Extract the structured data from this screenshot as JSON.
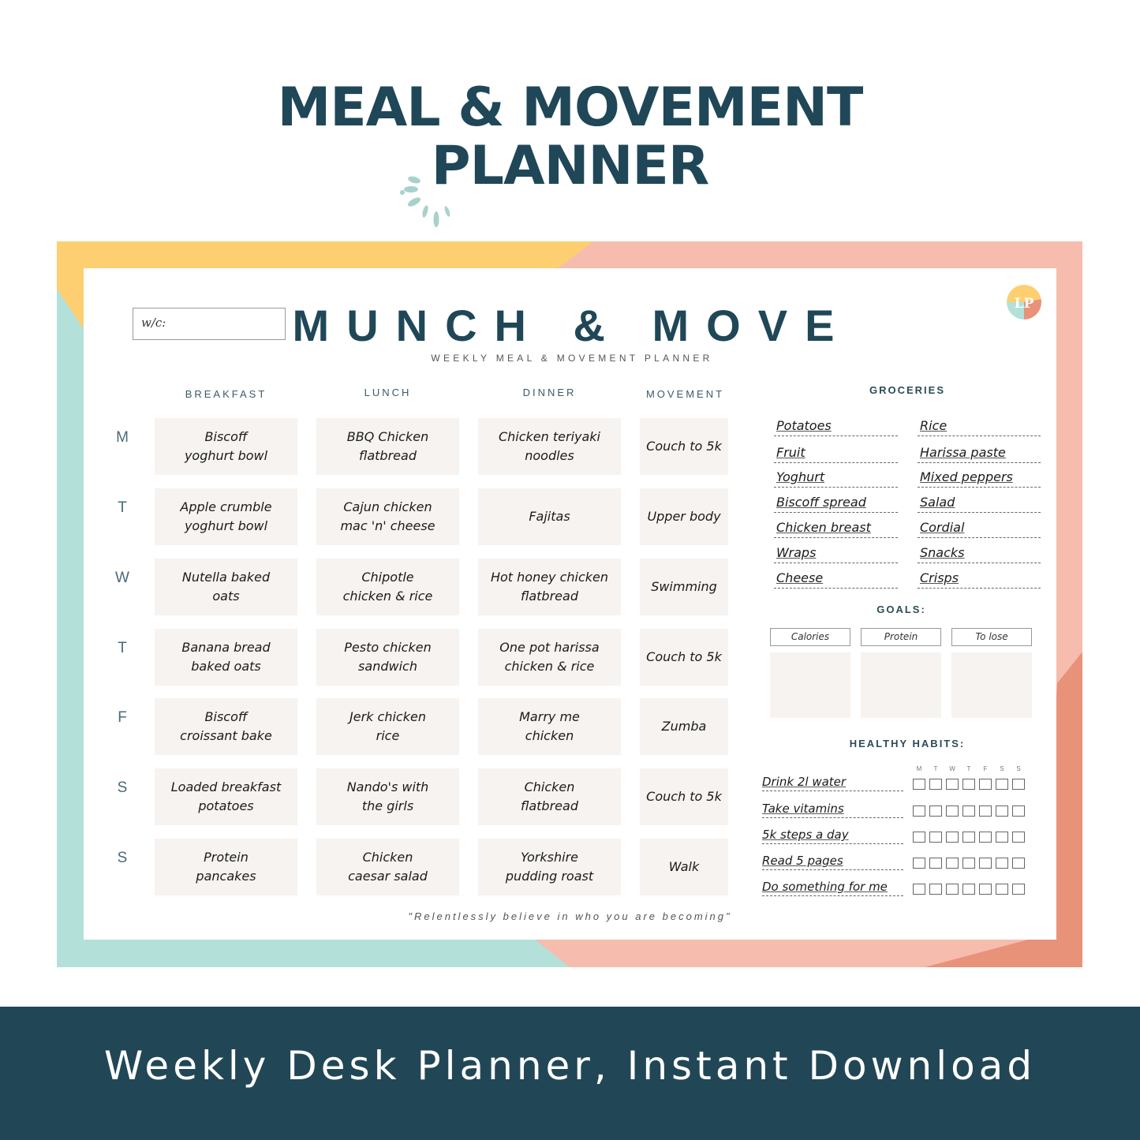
{
  "hero": {
    "title_line1": "MEAL & MOVEMENT",
    "title_line2": "PLANNER"
  },
  "planner": {
    "week_commencing_label": "w/c:",
    "title": "MUNCH & MOVE",
    "subtitle": "WEEKLY MEAL & MOVEMENT PLANNER",
    "logo_text": "LP",
    "columns": [
      "BREAKFAST",
      "LUNCH",
      "DINNER",
      "MOVEMENT"
    ],
    "days": [
      {
        "label": "M",
        "breakfast": "Biscoff\nyoghurt bowl",
        "lunch": "BBQ Chicken\nflatbread",
        "dinner": "Chicken teriyaki\nnoodles",
        "movement": "Couch to 5k"
      },
      {
        "label": "T",
        "breakfast": "Apple crumble\nyoghurt bowl",
        "lunch": "Cajun chicken\nmac 'n' cheese",
        "dinner": "Fajitas",
        "movement": "Upper body"
      },
      {
        "label": "W",
        "breakfast": "Nutella baked\noats",
        "lunch": "Chipotle\nchicken & rice",
        "dinner": "Hot honey chicken\nflatbread",
        "movement": "Swimming"
      },
      {
        "label": "T",
        "breakfast": "Banana bread\nbaked oats",
        "lunch": "Pesto chicken\nsandwich",
        "dinner": "One pot harissa\nchicken & rice",
        "movement": "Couch to 5k"
      },
      {
        "label": "F",
        "breakfast": "Biscoff\ncroissant bake",
        "lunch": "Jerk chicken\nrice",
        "dinner": "Marry me\nchicken",
        "movement": "Zumba"
      },
      {
        "label": "S",
        "breakfast": "Loaded breakfast\npotatoes",
        "lunch": "Nando's with\nthe girls",
        "dinner": "Chicken\nflatbread",
        "movement": "Couch to 5k"
      },
      {
        "label": "S",
        "breakfast": "Protein\npancakes",
        "lunch": "Chicken\ncaesar salad",
        "dinner": "Yorkshire\npudding roast",
        "movement": "Walk"
      }
    ],
    "groceries": {
      "heading": "GROCERIES",
      "left": [
        "Potatoes",
        "Fruit",
        "Yoghurt",
        "Biscoff spread",
        "Chicken breast",
        "Wraps",
        "Cheese"
      ],
      "right": [
        "Rice",
        "Harissa paste",
        "Mixed peppers",
        "Salad",
        "Cordial",
        "Snacks",
        "Crisps"
      ]
    },
    "goals": {
      "heading": "GOALS:",
      "items": [
        "Calories",
        "Protein",
        "To lose"
      ]
    },
    "habits": {
      "heading": "HEALTHY HABITS:",
      "day_letters": [
        "M",
        "T",
        "W",
        "T",
        "F",
        "S",
        "S"
      ],
      "items": [
        "Drink 2l water",
        "Take vitamins",
        "5k steps a day",
        "Read 5 pages",
        "Do something for me"
      ]
    },
    "quote": "\"Relentlessly believe in who you are becoming\""
  },
  "footer": {
    "text": "Weekly Desk Planner, Instant Download"
  },
  "colors": {
    "navy": "#1f4757",
    "footer_band": "#214757",
    "yellow": "#fdcf70",
    "mint": "#b3e1d9",
    "pink": "#f6bcae",
    "coral": "#e8927a",
    "cell_bg": "#f6f3f0"
  }
}
